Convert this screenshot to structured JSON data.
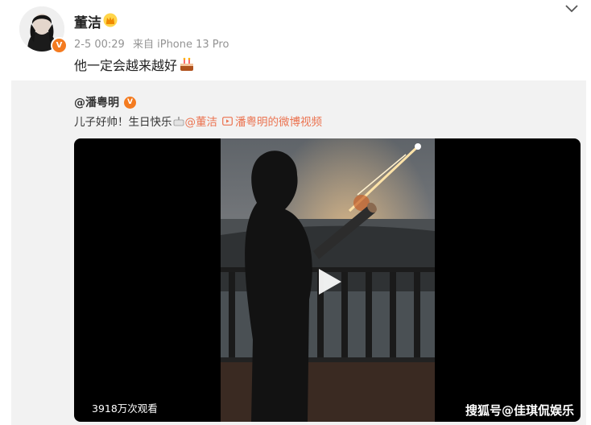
{
  "post": {
    "author": "董洁",
    "timestamp": "2-5 00:29",
    "source": "来自 iPhone 13 Pro",
    "text": "他一定会越来越好",
    "verified_badge": "V",
    "icons": [
      "crown-icon",
      "cake-icon",
      "chevron-down-icon"
    ]
  },
  "repost": {
    "author": "@潘粤明",
    "verified_badge": "V",
    "text": "儿子好帅！生日快乐",
    "mention": "@董洁",
    "video_link": "潘粤明的微博视频"
  },
  "video": {
    "views": "3918万次观看"
  },
  "watermark": "搜狐号@佳琪侃娱乐",
  "colors": {
    "accent": "#eb7350",
    "badge": "#f47b20",
    "repost_bg": "#f2f2f2"
  }
}
